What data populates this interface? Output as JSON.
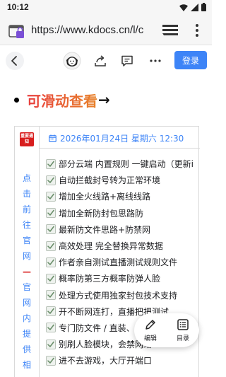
{
  "status_bar": {
    "time": "10:12"
  },
  "browser": {
    "url": "https://www.kdocs.cn/l/c"
  },
  "doc_toolbar": {
    "login_label": "登录"
  },
  "heading": {
    "title": "可滑动查看",
    "arrow": "→"
  },
  "card": {
    "badge_text": "重要通知",
    "date": "2026年01月24日 星期六 12:30",
    "vertical_link": [
      "点",
      "击",
      "前",
      "往",
      "官",
      "网",
      "—",
      "官",
      "网",
      "内",
      "提",
      "供",
      "相"
    ],
    "items": [
      "部分云端 内置规则 一键启动（更新i",
      "自动拦截封号转为正常环境",
      "增加全火线路+离线线路",
      "增加全新防封包思路防",
      "最新防文件思路+防禁网",
      "高效处理 完全替换异常数据",
      "作者亲自测试直播测试规则文件",
      "概率防第三方概率防弹人脸",
      "处理方式使用独家封包技术支持",
      "开不断网连打，直播把把测试",
      "专门防文件 / 直装、",
      "别刷人脸模块，会禁网络",
      "进不去游戏，大厅开端口"
    ]
  },
  "fab": {
    "edit_label": "编辑",
    "toc_label": "目录"
  },
  "colors": {
    "accent": "#3d84f7",
    "heading_start": "#e83e3e",
    "heading_end": "#e8832a",
    "badge": "#d81e1e"
  }
}
